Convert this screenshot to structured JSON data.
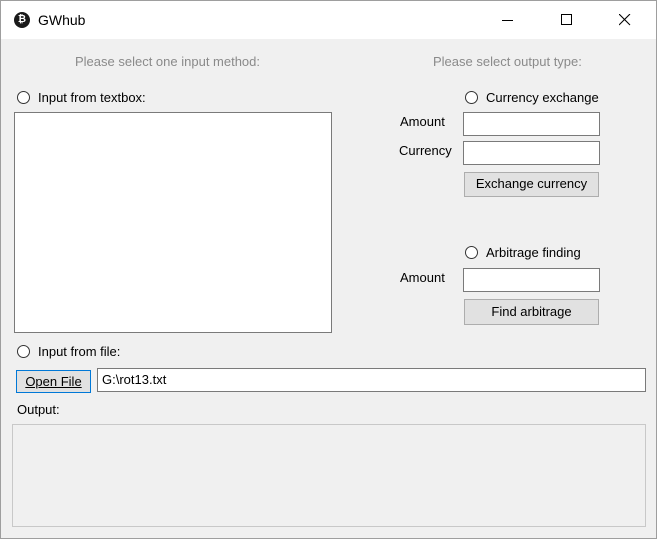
{
  "window": {
    "title": "GWhub",
    "app_icon": "bitcoin-icon",
    "controls": [
      "minimize-icon",
      "maximize-icon",
      "close-icon"
    ]
  },
  "input": {
    "heading": "Please select one input method:",
    "textbox_option": "Input from textbox:",
    "textbox_value": "",
    "file_option": "Input from file:",
    "open_file_button": "Open File",
    "file_path": "G:\\rot13.txt"
  },
  "output": {
    "heading": "Please select output type:",
    "currency_exchange": {
      "option": "Currency exchange",
      "amount_label": "Amount",
      "amount_value": "",
      "currency_label": "Currency",
      "currency_value": "",
      "button": "Exchange currency"
    },
    "arbitrage": {
      "option": "Arbitrage finding",
      "amount_label": "Amount",
      "amount_value": "",
      "button": "Find arbitrage"
    },
    "result_label": "Output:",
    "result_value": ""
  }
}
